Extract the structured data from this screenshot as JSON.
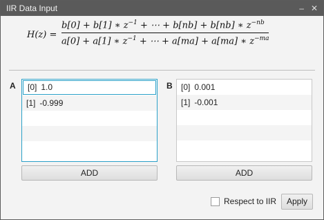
{
  "window": {
    "title": "IIR Data Input",
    "minimize_glyph": "–",
    "close_glyph": "✕"
  },
  "formula": {
    "lhs": "H(z) =",
    "numerator": "b[0] +  b[1] ∗ z",
    "numerator_mid": " + ⋯ + b[nb] +  b[nb] ∗ z",
    "num_exp1": "−1",
    "num_exp2": "−nb",
    "denominator": "a[0] +  a[1] ∗ z",
    "denominator_mid": " + ⋯ + a[ma] +  a[ma] ∗ z",
    "den_exp1": "−1",
    "den_exp2": "−ma"
  },
  "panel_a": {
    "label": "A",
    "rows": [
      {
        "index": "[0]",
        "value": "1.0"
      },
      {
        "index": "[1]",
        "value": "-0.999"
      }
    ],
    "add_label": "ADD"
  },
  "panel_b": {
    "label": "B",
    "rows": [
      {
        "index": "[0]",
        "value": "0.001"
      },
      {
        "index": "[1]",
        "value": "-0.001"
      }
    ],
    "add_label": "ADD"
  },
  "footer": {
    "checkbox_label": "Respect to IIR",
    "checkbox_checked": false,
    "apply_label": "Apply"
  },
  "colors": {
    "titlebar": "#5a5a5a",
    "focus_border": "#2aa0c8"
  }
}
